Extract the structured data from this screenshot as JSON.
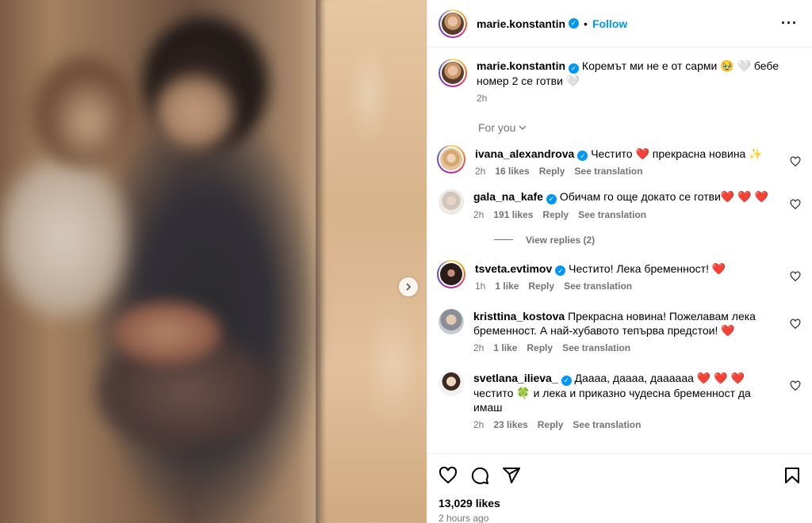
{
  "post": {
    "author": "marie.konstantin",
    "follow_label": "Follow",
    "caption_text": "Коремът ми не е от сарми 🥹 🤍 бебе номер 2 се готви 🤍",
    "caption_time": "2h"
  },
  "for_you_label": "For you",
  "comments": [
    {
      "user": "ivana_alexandrova",
      "text": "Честито ❤️ прекрасна новина ✨",
      "time": "2h",
      "likes": "16 likes",
      "reply": "Reply",
      "translate": "See translation"
    },
    {
      "user": "gala_na_kafe",
      "text": "Обичам го още докато се готви❤️ ❤️ ❤️",
      "time": "2h",
      "likes": "191 likes",
      "reply": "Reply",
      "translate": "See translation"
    },
    {
      "user": "tsveta.evtimov",
      "text": "Честито! Лека бременност! ❤️",
      "time": "1h",
      "likes": "1 like",
      "reply": "Reply",
      "translate": "See translation"
    },
    {
      "user": "kristtina_kostova",
      "text": "Прекрасна новина! Пожелавам лека бременност. А най-хубавото тепърва предстои! ❤️",
      "time": "2h",
      "likes": "1 like",
      "reply": "Reply",
      "translate": "See translation"
    },
    {
      "user": "svetlana_ilieva_",
      "text": "Даааа, даааа, даааааа ❤️ ❤️ ❤️ честито 🍀 и лека и приказно чудесна бременност да имаш",
      "time": "2h",
      "likes": "23 likes",
      "reply": "Reply",
      "translate": "See translation"
    }
  ],
  "view_replies_label": "View replies (2)",
  "likes_count": "13,029 likes",
  "posted_ago": "2 hours ago",
  "icons": [
    "heart-icon",
    "comment-icon",
    "share-icon",
    "save-icon",
    "more-icon",
    "chevron-right-icon",
    "chevron-down-icon"
  ],
  "colors": {
    "accent": "#0095f6",
    "like": "#ed4956",
    "muted": "#737373"
  }
}
